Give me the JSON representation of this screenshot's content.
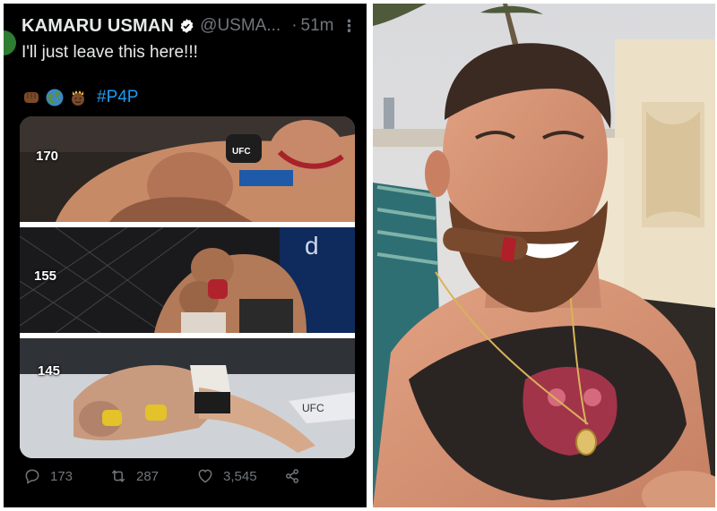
{
  "tweet": {
    "display_name": "KAMARU USMAN",
    "handle": "@USMA...",
    "separator": "·",
    "time": "51m",
    "more": "⋮",
    "text": "I'll just leave this here!!!",
    "emojis": [
      "fist-icon",
      "globe-icon",
      "crowned-face-icon"
    ],
    "hashtag": "#P4P",
    "media": {
      "panels": [
        {
          "weight_label": "170"
        },
        {
          "weight_label": "155"
        },
        {
          "weight_label": "145"
        }
      ]
    },
    "actions": {
      "replies": "173",
      "retweets": "287",
      "likes": "3,545"
    }
  },
  "colors": {
    "tweet_bg": "#000000",
    "primary_text": "#e7e9ea",
    "secondary_text": "#71767b",
    "link": "#1d9bf0",
    "verified": "#ffffff"
  }
}
